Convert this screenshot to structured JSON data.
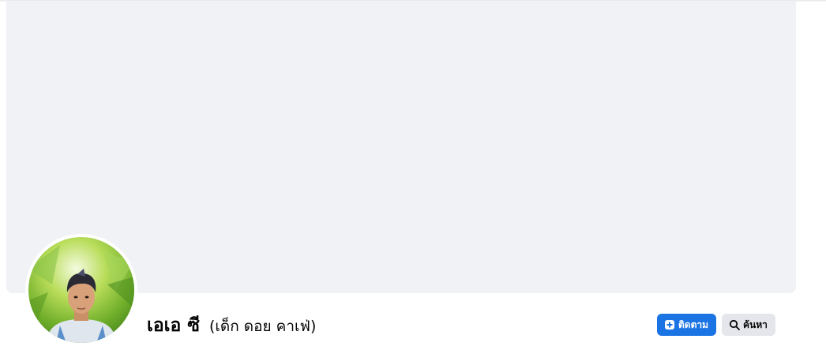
{
  "profile": {
    "name": "เอเอ ซี",
    "alternate_name": "(เด็ก ดอย คาเฟ่)"
  },
  "actions": {
    "follow_label": "ติดตาม",
    "search_label": "ค้นหา"
  },
  "colors": {
    "primary_button": "#1b74e4",
    "secondary_button": "#e4e6eb",
    "cover_background": "#f0f2f5"
  },
  "icons": {
    "follow": "follow-plus-icon",
    "search": "search-icon"
  }
}
